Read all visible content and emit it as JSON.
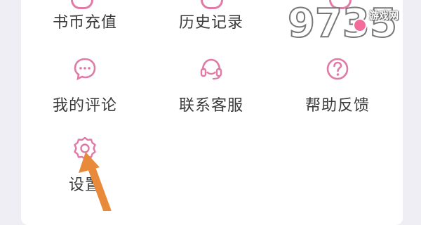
{
  "menu": {
    "row1": [
      {
        "label": "书币充值",
        "icon": "coin-icon"
      },
      {
        "label": "历史记录",
        "icon": "history-icon"
      },
      {
        "label": "",
        "icon": "partial-icon"
      }
    ],
    "row2": [
      {
        "label": "我的评论",
        "icon": "comment-icon"
      },
      {
        "label": "联系客服",
        "icon": "headset-icon"
      },
      {
        "label": "帮助反馈",
        "icon": "help-icon"
      }
    ],
    "row3": [
      {
        "label": "设置",
        "icon": "gear-icon"
      }
    ]
  },
  "watermark": {
    "text": "9735游戏网",
    "site": "游戏网"
  },
  "colors": {
    "accent": "#e07aa6",
    "arrow": "#e88a3a",
    "text": "#3a3a3a"
  }
}
